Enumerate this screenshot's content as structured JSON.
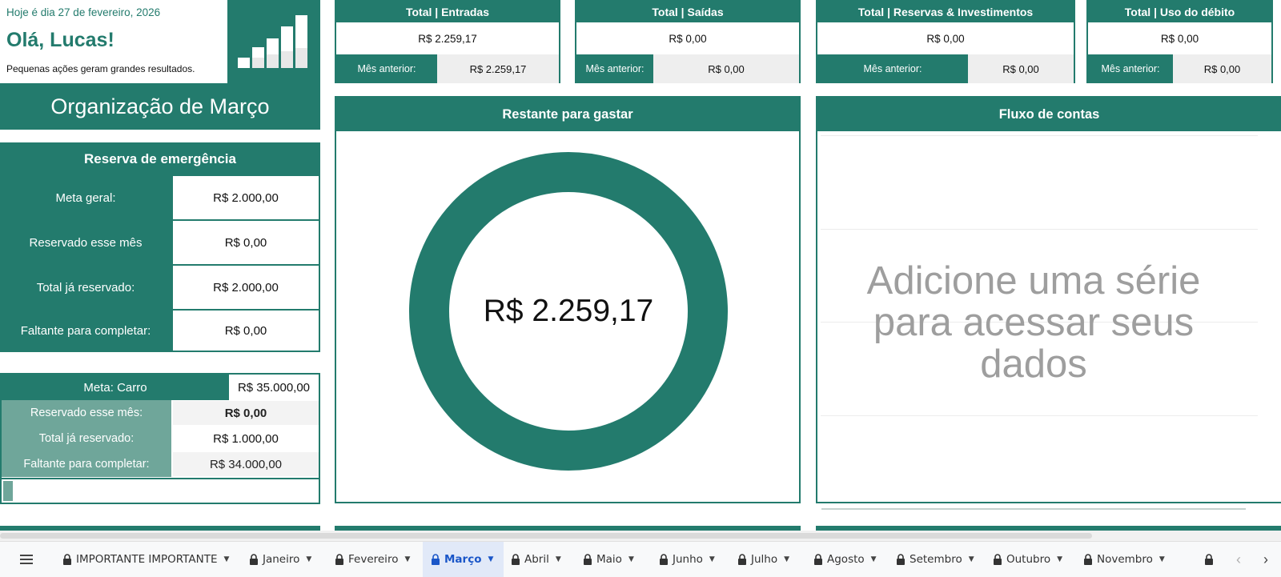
{
  "greeting": {
    "date_text": "Hoje é dia 27 de fevereiro, 2026",
    "hello": "Olá, Lucas!",
    "tagline": "Pequenas ações geram grandes resultados."
  },
  "month_title": "Organização de Março",
  "summary_cards": [
    {
      "title_left": "Total",
      "title_right": "Entradas",
      "value": "R$ 2.259,17",
      "prev_label": "Mês anterior:",
      "prev_value": "R$ 2.259,17"
    },
    {
      "title_left": "Total",
      "title_right": "Saídas",
      "value": "R$ 0,00",
      "prev_label": "Mês anterior:",
      "prev_value": "R$ 0,00"
    },
    {
      "title_left": "Total",
      "title_right": "Reservas & Investimentos",
      "value": "R$ 0,00",
      "prev_label": "Mês anterior:",
      "prev_value": "R$ 0,00"
    },
    {
      "title_left": "Total",
      "title_right": "Uso do débito",
      "value": "R$ 0,00",
      "prev_label": "Mês anterior:",
      "prev_value": "R$ 0,00"
    }
  ],
  "emergency": {
    "title": "Reserva de emergência",
    "rows": [
      {
        "label": "Meta geral:",
        "value": "R$ 2.000,00"
      },
      {
        "label": "Reservado esse mês",
        "value": "R$ 0,00"
      },
      {
        "label": "Total já reservado:",
        "value": "R$ 2.000,00"
      },
      {
        "label": "Faltante para completar:",
        "value": "R$ 0,00"
      }
    ]
  },
  "goal": {
    "label": "Meta: Carro",
    "value": "R$ 35.000,00",
    "rows": [
      {
        "label": "Reservado esse mês:",
        "value": "R$ 0,00"
      },
      {
        "label": "Total já reservado:",
        "value": "R$ 1.000,00"
      },
      {
        "label": "Faltante para completar:",
        "value": "R$ 34.000,00"
      }
    ],
    "progress_fraction": 0.03
  },
  "remaining": {
    "title": "Restante para gastar",
    "value": "R$ 2.259,17"
  },
  "flow": {
    "title": "Fluxo de contas",
    "placeholder": "Adicione uma série para acessar seus dados"
  },
  "colors": {
    "accent": "#237b6d",
    "accent_light": "#6fa69a",
    "active_tab": "#1a56c8"
  },
  "sheet_tabs": {
    "menu_icon": "hamburger-icon",
    "items": [
      {
        "label": "IMPORTANTE IMPORTANTE",
        "active": false
      },
      {
        "label": "Janeiro",
        "active": false
      },
      {
        "label": "Fevereiro",
        "active": false
      },
      {
        "label": "Março",
        "active": true
      },
      {
        "label": "Abril",
        "active": false
      },
      {
        "label": "Maio",
        "active": false
      },
      {
        "label": "Junho",
        "active": false
      },
      {
        "label": "Julho",
        "active": false
      },
      {
        "label": "Agosto",
        "active": false
      },
      {
        "label": "Setembro",
        "active": false
      },
      {
        "label": "Outubro",
        "active": false
      },
      {
        "label": "Novembro",
        "active": false
      }
    ]
  }
}
